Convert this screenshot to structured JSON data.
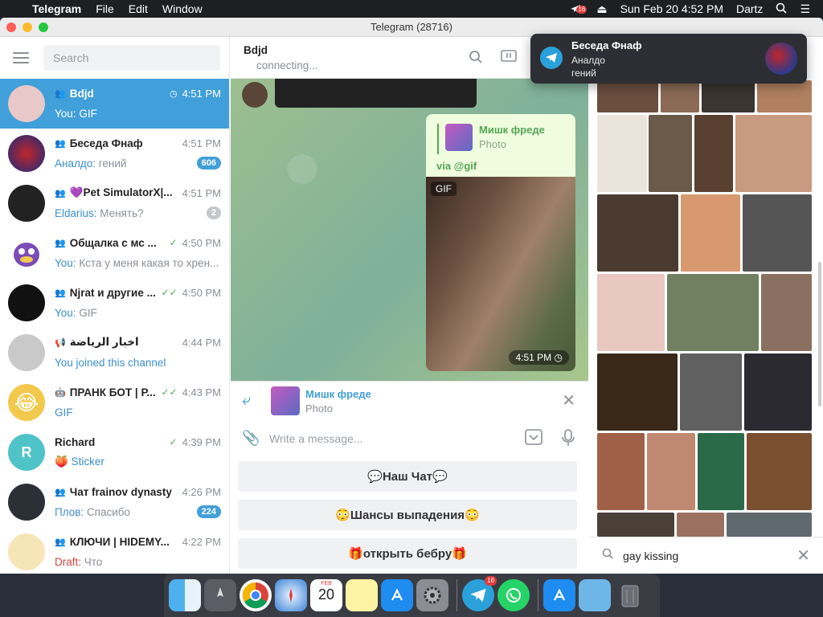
{
  "menubar": {
    "app_name": "Telegram",
    "items": [
      "File",
      "Edit",
      "Window"
    ],
    "clock": "Sun Feb 20  4:52 PM",
    "user": "Dartz",
    "tg_badge": "16"
  },
  "window": {
    "title": "Telegram (28716)"
  },
  "sidebar": {
    "search_placeholder": "Search",
    "chats": [
      {
        "name": "Bdjd",
        "time": "4:51 PM",
        "who": "You:",
        "preview": "GIF",
        "badge": "",
        "avatar_color": "#e8c8c8",
        "avatar_text": ""
      },
      {
        "name": "Беседа Фнаф",
        "time": "4:51 PM",
        "who": "Аналдо:",
        "preview": "гений",
        "badge": "606",
        "avatar_color": "#9a1e2a",
        "avatar_text": ""
      },
      {
        "name": "💜Pet SimulatorX|...",
        "time": "4:51 PM",
        "who": "Eldarius:",
        "preview": "Менять?",
        "badge": "2",
        "avatar_color": "#222222",
        "avatar_text": ""
      },
      {
        "name": "Общалка с мс ...",
        "time": "4:50 PM",
        "who": "You:",
        "preview": "Кста у меня какая то хрен...",
        "badge": "",
        "avatar_color": "#7b4bb8",
        "avatar_text": ""
      },
      {
        "name": "Njrat и другие ...",
        "time": "4:50 PM",
        "who": "You:",
        "preview": "GIF",
        "badge": "",
        "avatar_color": "#111111",
        "avatar_text": ""
      },
      {
        "name": "اخبار الرياضة",
        "time": "4:44 PM",
        "who": "",
        "preview": "You joined this channel",
        "badge": "",
        "avatar_color": "#c9c9c9",
        "avatar_text": ""
      },
      {
        "name": "ПРАНК БОТ | Р...",
        "time": "4:43 PM",
        "who": "",
        "preview": "GIF",
        "badge": "",
        "avatar_color": "#f2c94c",
        "avatar_text": "😂"
      },
      {
        "name": "Richard",
        "time": "4:39 PM",
        "who": "",
        "preview": "🍑 Sticker",
        "badge": "",
        "avatar_color": "#4fc3c8",
        "avatar_text": "R"
      },
      {
        "name": "Чат frainov dynasty",
        "time": "4:26 PM",
        "who": "Плов:",
        "preview": "Спасибо",
        "badge": "224",
        "avatar_color": "#2b2f36",
        "avatar_text": ""
      },
      {
        "name": "КЛЮЧИ | HIDEMY...",
        "time": "4:22 PM",
        "who": "Draft:",
        "preview": "Что",
        "badge": "",
        "avatar_color": "#f5e6b8",
        "avatar_text": ""
      }
    ]
  },
  "chat": {
    "title": "Bdjd",
    "status": "connecting...",
    "reply_name": "Мишк фреде",
    "reply_type": "Photo",
    "via": "via @gif",
    "gif_label": "GIF",
    "gif_time": "4:51 PM",
    "replybar_name": "Мишк фреде",
    "replybar_type": "Photo",
    "compose_placeholder": "Write a message...",
    "keyboard": [
      "💬Наш Чат💬",
      "😳Шансы выпадения😳",
      "🎁открыть бебру🎁"
    ]
  },
  "gifpanel": {
    "search_value": "gay kissing"
  },
  "notification": {
    "title": "Беседа Фнаф",
    "sender": "Аналдо",
    "body": "гений"
  },
  "dock": {
    "calendar_month": "FEB",
    "calendar_day": "20",
    "telegram_badge": "16"
  }
}
